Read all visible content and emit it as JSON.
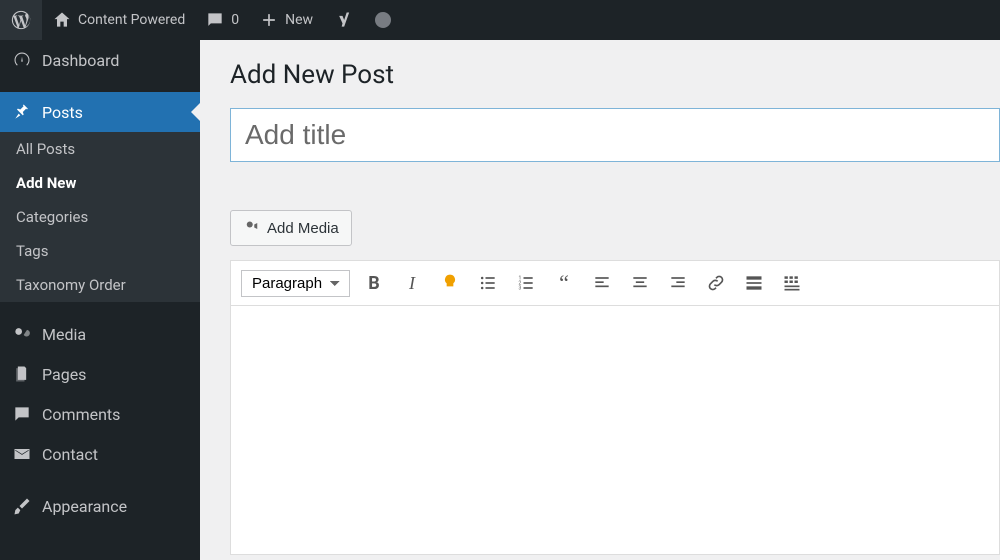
{
  "topbar": {
    "site_name": "Content Powered",
    "comments_count": "0",
    "new_label": "New"
  },
  "sidebar": {
    "dashboard": "Dashboard",
    "posts": "Posts",
    "posts_sub": {
      "all": "All Posts",
      "add_new": "Add New",
      "categories": "Categories",
      "tags": "Tags",
      "taxonomy_order": "Taxonomy Order"
    },
    "media": "Media",
    "pages": "Pages",
    "comments": "Comments",
    "contact": "Contact",
    "appearance": "Appearance"
  },
  "content": {
    "page_title": "Add New Post",
    "title_placeholder": "Add title",
    "add_media_label": "Add Media",
    "format_select": "Paragraph"
  }
}
